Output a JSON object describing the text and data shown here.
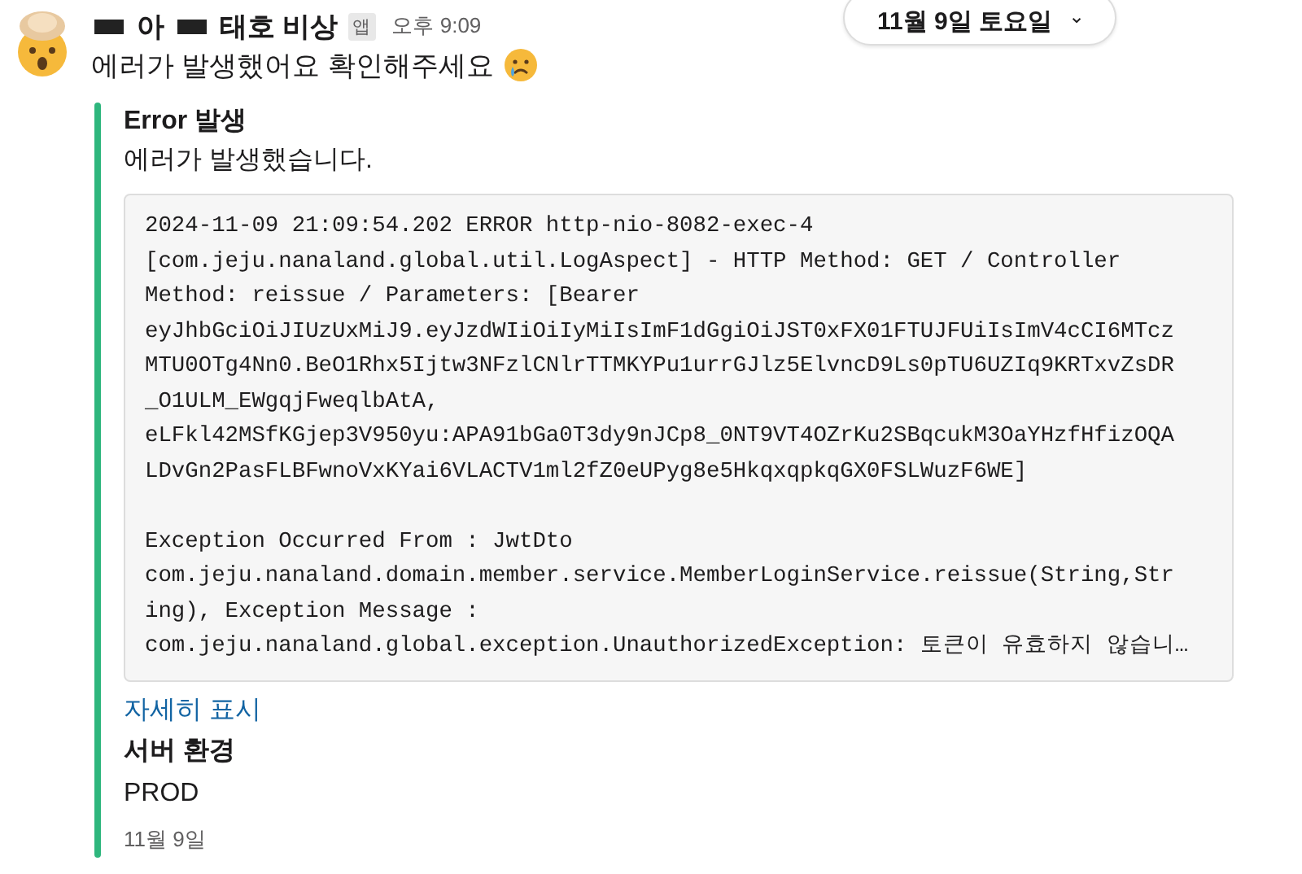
{
  "date_pill": {
    "label": "11월 9일 토요일",
    "caret": "⌄"
  },
  "message": {
    "sender_parts": [
      "아",
      "태호 비상"
    ],
    "app_badge": "앱",
    "time": "오후 9:09",
    "text": "에러가 발생했어요 확인해주세요",
    "attachment": {
      "title": "Error 발생",
      "subtitle": "에러가 발생했습니다.",
      "code_paragraphs": [
        [
          "2024-11-09 21:09:54.202 ERROR http-nio-8082-exec-4",
          "[com.jeju.nanaland.global.util.LogAspect] - HTTP Method: GET / Controller",
          "Method: reissue / Parameters: [Bearer",
          "eyJhbGciOiJIUzUxMiJ9.eyJzdWIiOiIyMiIsImF1dGgiOiJST0xFX01FTUJFUiIsImV4cCI6MTcz",
          "MTU0OTg4Nn0.BeO1Rhx5Ijtw3NFzlCNlrTTMKYPu1urrGJlz5ElvncD9Ls0pTU6UZIq9KRTxvZsDR",
          "_O1ULM_EWgqjFweqlbAtA,",
          "eLFkl42MSfKGjep3V950yu:APA91bGa0T3dy9nJCp8_0NT9VT4OZrKu2SBqcukM3OaYHzfHfizOQA",
          "LDvGn2PasFLBFwnoVxKYai6VLACTV1ml2fZ0eUPyg8e5HkqxqpkqGX0FSLWuzF6WE]"
        ],
        [
          "Exception Occurred From : JwtDto",
          "com.jeju.nanaland.domain.member.service.MemberLoginService.reissue(String,Str",
          "ing), Exception Message :",
          "com.jeju.nanaland.global.exception.UnauthorizedException: 토큰이 유효하지 않습니…"
        ]
      ],
      "show_more": "자세히 표시",
      "field_title": "서버 환경",
      "field_value": "PROD",
      "footer": "11월 9일"
    }
  }
}
